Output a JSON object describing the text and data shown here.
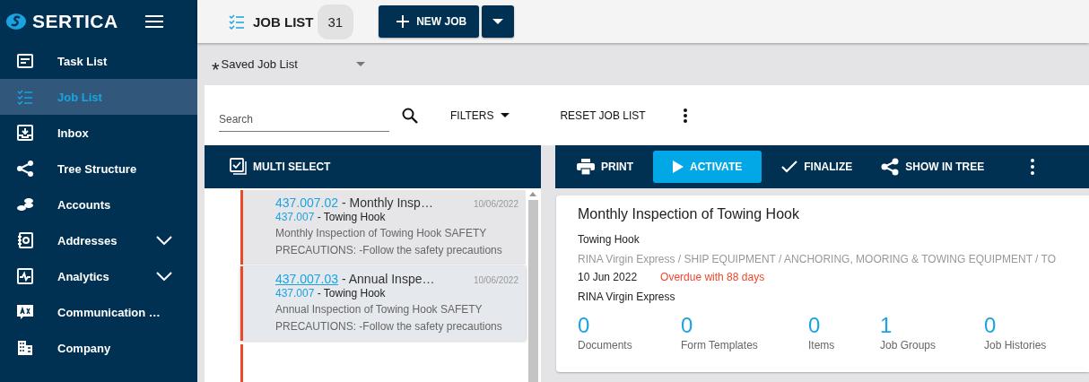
{
  "app": {
    "logo": "SERTICA"
  },
  "sidebar": {
    "items": [
      {
        "kind": "task",
        "label": "Task List",
        "selected": false,
        "expandable": false
      },
      {
        "kind": "job",
        "label": "Job List",
        "selected": true,
        "expandable": false
      },
      {
        "kind": "inbox",
        "label": "Inbox",
        "selected": false,
        "expandable": false
      },
      {
        "kind": "tree",
        "label": "Tree Structure",
        "selected": false,
        "expandable": false
      },
      {
        "kind": "accounts",
        "label": "Accounts",
        "selected": false,
        "expandable": false
      },
      {
        "kind": "addresses",
        "label": "Addresses",
        "selected": false,
        "expandable": true
      },
      {
        "kind": "analytics",
        "label": "Analytics",
        "selected": false,
        "expandable": true
      },
      {
        "kind": "communication",
        "label": "Communication …",
        "selected": false,
        "expandable": false
      },
      {
        "kind": "company",
        "label": "Company",
        "selected": false,
        "expandable": false
      }
    ]
  },
  "header": {
    "title": "JOB LIST",
    "count": "31",
    "new_job": "NEW JOB"
  },
  "saved_list": {
    "marker": "*",
    "label": "Saved Job List"
  },
  "toolbar": {
    "search_placeholder": "Search",
    "filters": "FILTERS",
    "reset": "RESET JOB LIST"
  },
  "list_header": {
    "multi_select": "MULTI SELECT"
  },
  "jobs": [
    {
      "number": "437.007.02",
      "title": " - Monthly Insp…",
      "date": "10/06/2022",
      "parent_number": "437.007",
      "parent_name": " - Towing Hook",
      "description": "Monthly Inspection of Towing Hook SAFETY PRECAUTIONS: -Follow the safety precautions",
      "selected": false
    },
    {
      "number": "437.007.03",
      "title": " - Annual Inspe…",
      "date": "10/06/2022",
      "parent_number": "437.007",
      "parent_name": " - Towing Hook",
      "description": "Annual Inspection of Towing Hook SAFETY PRECAUTIONS: -Follow the safety precautions",
      "selected": true
    }
  ],
  "actions": [
    {
      "kind": "print",
      "label": "PRINT",
      "selected": false
    },
    {
      "kind": "activate",
      "label": "ACTIVATE",
      "selected": true
    },
    {
      "kind": "finalize",
      "label": "FINALIZE",
      "selected": false
    },
    {
      "kind": "tree",
      "label": "SHOW IN TREE",
      "selected": false
    }
  ],
  "detail": {
    "title": "Monthly Inspection of Towing Hook",
    "component": "Towing Hook",
    "path": "RINA Virgin Express / SHIP EQUIPMENT / ANCHORING, MOORING & TOWING EQUIPMENT / TO",
    "date": "10 Jun 2022",
    "overdue": "Overdue with 88 days",
    "vessel": "RINA Virgin Express",
    "stats": [
      {
        "value": "0",
        "label": "Documents"
      },
      {
        "value": "0",
        "label": "Form Templates"
      },
      {
        "value": "0",
        "label": "Items"
      },
      {
        "value": "1",
        "label": "Job Groups"
      },
      {
        "value": "0",
        "label": "Job Histories"
      }
    ]
  }
}
